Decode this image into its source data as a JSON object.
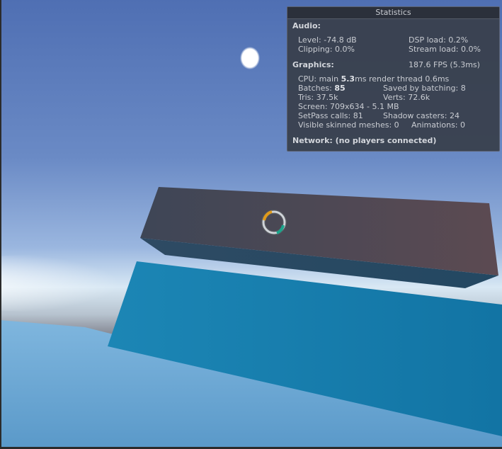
{
  "stats_panel": {
    "title": "Statistics",
    "audio": {
      "heading": "Audio:",
      "level": "Level: -74.8 dB",
      "dsp_load": "DSP load: 0.2%",
      "clipping": "Clipping: 0.0%",
      "stream_load": "Stream load: 0.0%"
    },
    "graphics": {
      "heading": "Graphics:",
      "fps": "187.6 FPS (5.3ms)",
      "cpu_prefix": "CPU: main ",
      "cpu_main_ms": "5.3",
      "cpu_suffix": "ms  render thread 0.6ms",
      "batches_prefix": "Batches: ",
      "batches_value": "85",
      "saved_by_batching": "Saved by batching: 8",
      "tris": "Tris: 37.5k",
      "verts": "Verts: 72.6k",
      "screen": "Screen: 709x634 - 5.1 MB",
      "setpass": "SetPass calls: 81",
      "shadow_casters": "Shadow casters: 24",
      "skinned_meshes": "Visible skinned meshes: 0",
      "animations": "Animations: 0"
    },
    "network": "Network: (no players connected)"
  },
  "colors": {
    "sky_top": "#4f6fb3",
    "box_top": "#4a4f5e",
    "box_front": "#5a4e58",
    "panel_blue": "#1a82b0",
    "water": "#6ea8d4",
    "reticle_orange": "#e09a1a",
    "reticle_green": "#1aa58c"
  }
}
